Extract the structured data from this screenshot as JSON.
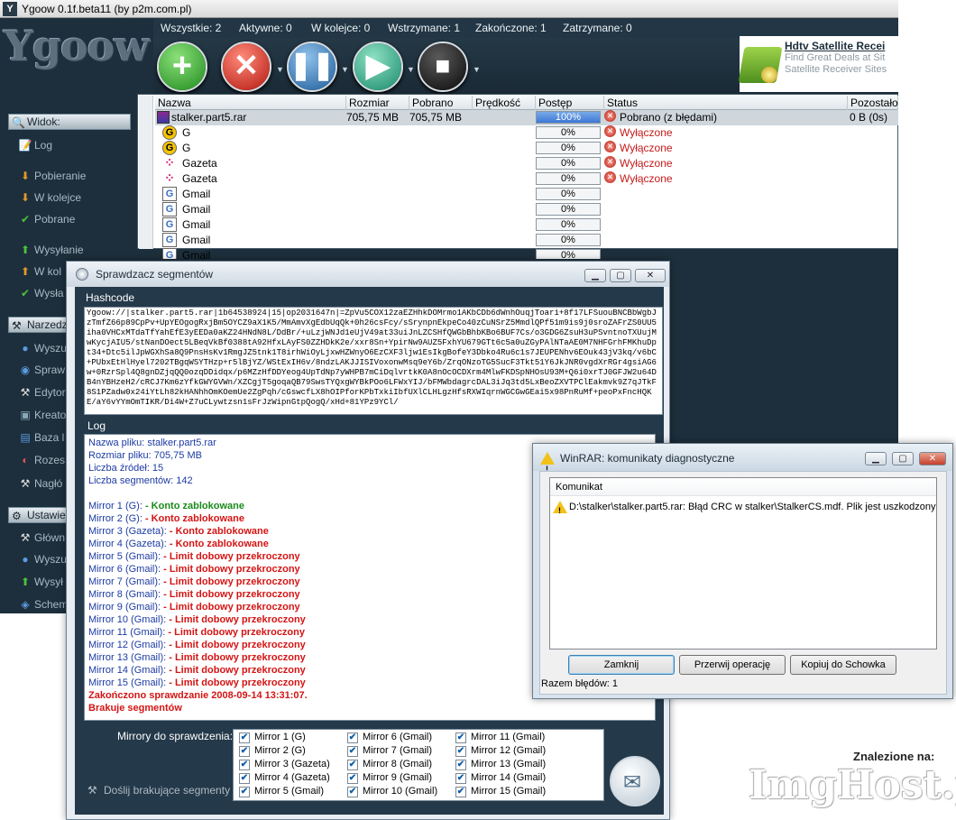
{
  "app": {
    "title": "Ygoow 0.1f.beta11 (by p2m.com.pl)",
    "logo": "Ygoow"
  },
  "stats": {
    "all": "Wszystkie: 2",
    "active": "Aktywne: 0",
    "queued": "W kolejce: 0",
    "paused": "Wstrzymane: 1",
    "finished": "Zakończone: 1",
    "stopped": "Zatrzymane: 0"
  },
  "toolbar": {
    "add_icon": "plus-icon",
    "remove_icon": "x-icon",
    "pause_icon": "pause-icon",
    "play_icon": "play-icon",
    "stop_icon": "stop-icon"
  },
  "ad": {
    "title": "Hdtv Satellite Recei",
    "line1": "Find Great Deals at Sit",
    "line2": "Satellite Receiver Sites"
  },
  "sidebar": {
    "view_header": "Widok:",
    "view_items": [
      "Log",
      "Pobieranie",
      "W kolejce",
      "Pobrane",
      "Wysyłanie",
      "W kol",
      "Wysła"
    ],
    "tools_header": "Narzedz",
    "tools_items": [
      "Wyszu",
      "Spraw",
      "Edytor",
      "Kreato",
      "Baza l",
      "Rozes",
      "Nagłó"
    ],
    "settings_header": "Ustawie",
    "settings_items": [
      "Główn",
      "Wyszu",
      "Wysył",
      "Schem"
    ]
  },
  "grid": {
    "columns": [
      "Nazwa",
      "Rozmiar",
      "Pobrano",
      "Prędkość",
      "Postęp",
      "Status",
      "Pozostało"
    ],
    "rows": [
      {
        "name": "stalker.part5.rar",
        "size": "705,75 MB",
        "downloaded": "705,75 MB",
        "progress": "100%",
        "status": "Pobrano (z błędami)",
        "remaining": "0 B (0s)"
      },
      {
        "name": "G",
        "progress": "0%",
        "status": "Wyłączone"
      },
      {
        "name": "G",
        "progress": "0%",
        "status": "Wyłączone"
      },
      {
        "name": "Gazeta",
        "progress": "0%",
        "status": "Wyłączone"
      },
      {
        "name": "Gazeta",
        "progress": "0%",
        "status": "Wyłączone"
      },
      {
        "name": "Gmail",
        "progress": "0%",
        "status": ""
      },
      {
        "name": "Gmail",
        "progress": "0%",
        "status": ""
      },
      {
        "name": "Gmail",
        "progress": "0%",
        "status": ""
      },
      {
        "name": "Gmail",
        "progress": "0%",
        "status": ""
      },
      {
        "name": "Gmail",
        "progress": "0%",
        "status": ""
      }
    ]
  },
  "segments": {
    "title": "Sprawdzacz segmentów",
    "hashcode_label": "Hashcode",
    "hashcode": "Ygoow://|stalker.part5.rar|1b64538924|15|op2031647n|=ZpVu5COX12zaEZHhkDOMrmo1AKbCDb6dWnhOuqjToari+8f17LFSuouBNCBbWgbJzTmfZ66p89CpPv+UpYEOgogRxjBm5OYCZ9aX1K5/MmAmvXgEdbUqQk+0h26csFcy/sSrynpnEkpeCo40zCuNSrZ5MmdlQPf51m9is9j0sroZAFrZS0UU5iha0VHCxMTdaTfYahEfE3yEEDa0aKZ24HNdN8L/DdBr/+uLzjWNJd1eUjV49at33uiJnLZCSHfQWGbBhbKBo6BUF7Cs/o3GDG6ZsuH3uPSvntnoTXUujMwKycjAIU5/stNanDOect5LBeqVkBf0388tA92HfxLAyFS0ZZHDkK2e/xxr8Sn+YpirNw9AUZ5FxhYU679GTt6c5a0uZGyPAlNTaAE0M7NHFGrhFMKhuDpt34+Dtc5ilJpWGXhSa8Q9PnsHsKv1RmgJZ5tnk1T8irhWiOyLjxwHZWnyO6EzCXF3ljw1EsIkgBofeY3Dbko4Ru6c1s7JEUPENhv6EOuk43jV3kq/v6bC+PUbxEtHlHyel7202TBgqWSYTHzp+r5lBjYZ/WStExIH6v/8ndzLAKJJISIVoxonwMsq9eY6b/ZrqONzoTG5SucF3Tkt51Y6JkJNR0vgdXrRGr4gsiAG6w+0RzrSpl4Q8gnDZjqQQ0ozqDDidqx/p6MZzHfDDYeog4UpTdNp7yWHPB7mCiDqlvrtkK0A8nOcOCDXrm4MlwFKDSpNHOsU93M+Q6i0xrTJ0GFJW2u64DB4nYBHzeH2/cRCJ7Km6zYfkGWYGVWn/XZCgjT5goqaQB79SwsTYQxgWYBkPOo6LFWxYIJ/bFMWbdagrcDAL3iJq3td5LxBeoZXVTPClEakmvk9Z7qJTkF8S1PZadw0x24iYtLh82kHANhhOmKOemUe2ZgPqh/cGswcfLX8hOIPforKPbTxkiIbfUXlCLHLgzHfsRXWIqrnWGCGwGEai5x98PnRuMf+peoPxFncHQKE/aY6vYYmOmTIKR/Di4W+Z7uCLywtzsn1sFrJzWipnGtpQogQ/xHd+81YPz9YCl/",
    "log_label": "Log",
    "log_info": [
      "Nazwa pliku: stalker.part5.rar",
      "Rozmiar pliku: 705,75 MB",
      "Liczba źródeł: 15",
      "Liczba segmentów: 142"
    ],
    "log_mirrors": [
      {
        "prefix": "Mirror 1 (G): ",
        "msg": " - Konto zablokowane",
        "ok": true
      },
      {
        "prefix": "Mirror 2 (G): ",
        "msg": " - Konto zablokowane",
        "ok": false
      },
      {
        "prefix": "Mirror 3 (Gazeta): ",
        "msg": " - Konto zablokowane",
        "ok": false
      },
      {
        "prefix": "Mirror 4 (Gazeta): ",
        "msg": " - Konto zablokowane",
        "ok": false
      },
      {
        "prefix": "Mirror 5 (Gmail): ",
        "msg": " - Limit dobowy przekroczony",
        "ok": false
      },
      {
        "prefix": "Mirror 6 (Gmail): ",
        "msg": " - Limit dobowy przekroczony",
        "ok": false
      },
      {
        "prefix": "Mirror 7 (Gmail): ",
        "msg": " - Limit dobowy przekroczony",
        "ok": false
      },
      {
        "prefix": "Mirror 8 (Gmail): ",
        "msg": " - Limit dobowy przekroczony",
        "ok": false
      },
      {
        "prefix": "Mirror 9 (Gmail): ",
        "msg": " - Limit dobowy przekroczony",
        "ok": false
      },
      {
        "prefix": "Mirror 10 (Gmail): ",
        "msg": " - Limit dobowy przekroczony",
        "ok": false
      },
      {
        "prefix": "Mirror 11 (Gmail): ",
        "msg": " - Limit dobowy przekroczony",
        "ok": false
      },
      {
        "prefix": "Mirror 12 (Gmail): ",
        "msg": " - Limit dobowy przekroczony",
        "ok": false
      },
      {
        "prefix": "Mirror 13 (Gmail): ",
        "msg": " - Limit dobowy przekroczony",
        "ok": false
      },
      {
        "prefix": "Mirror 14 (Gmail): ",
        "msg": " - Limit dobowy przekroczony",
        "ok": false
      },
      {
        "prefix": "Mirror 15 (Gmail): ",
        "msg": " - Limit dobowy przekroczony",
        "ok": false
      }
    ],
    "log_end1": "Zakończono sprawdzanie 2008-09-14 13:31:07.",
    "log_end2": "Brakuje segmentów",
    "mirrors_label": "Mirrory do sprawdzenia:",
    "mirrors": [
      "Mirror 1 (G)",
      "Mirror 2 (G)",
      "Mirror 3 (Gazeta)",
      "Mirror 4 (Gazeta)",
      "Mirror 5 (Gmail)",
      "Mirror 6 (Gmail)",
      "Mirror 7 (Gmail)",
      "Mirror 8 (Gmail)",
      "Mirror 9 (Gmail)",
      "Mirror 10 (Gmail)",
      "Mirror 11 (Gmail)",
      "Mirror 12 (Gmail)",
      "Mirror 13 (Gmail)",
      "Mirror 14 (Gmail)",
      "Mirror 15 (Gmail)"
    ],
    "send_missing": "Doślij brakujące segmenty"
  },
  "winrar": {
    "title": "WinRAR: komunikaty diagnostyczne",
    "column": "Komunikat",
    "message": "D:\\stalker\\stalker.part5.rar: Błąd CRC w stalker\\StalkerCS.mdf. Plik jest uszkodzony",
    "close": "Zamknij",
    "abort": "Przerwij operację",
    "copy": "Kopiuj do Schowka",
    "errors": "Razem błędów: 1"
  },
  "watermark": {
    "found_on": "Znalezione na:",
    "logo": "ImgHost.pl"
  },
  "colors": {
    "dark_bg": "#1d2f3c",
    "log_blue": "#1c3ba3",
    "log_green": "#1b8a1b",
    "log_red": "#d51414"
  }
}
